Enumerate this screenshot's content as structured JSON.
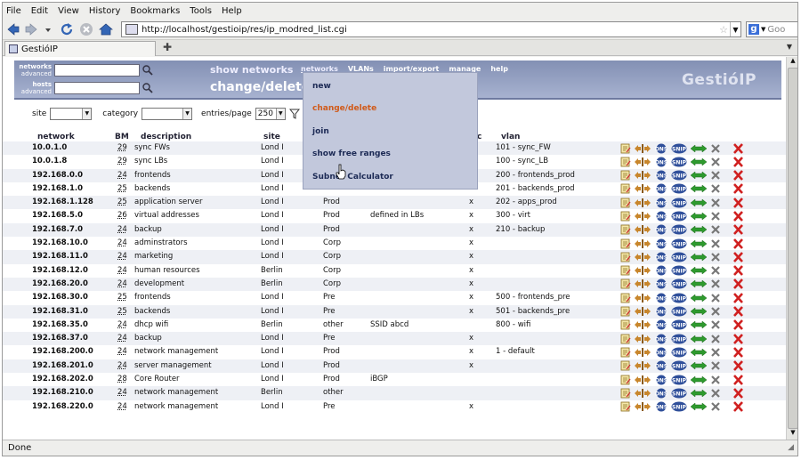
{
  "menubar": [
    "File",
    "Edit",
    "View",
    "History",
    "Bookmarks",
    "Tools",
    "Help"
  ],
  "url": "http://localhost/gestioip/res/ip_modred_list.cgi",
  "search_placeholder": "Goo",
  "tab_title": "GestióIP",
  "status": "Done",
  "header": {
    "networks_label": "networks",
    "networks_sub": "advanced",
    "hosts_label": "hosts",
    "hosts_sub": "advanced",
    "show_networks": "show networks",
    "change_delete": "change/delete",
    "nav": [
      "networks",
      "VLANs",
      "import/export",
      "manage",
      "help"
    ],
    "brand": "GestióIP"
  },
  "dropdown": [
    "new",
    "change/delete",
    "join",
    "show free ranges",
    "Subnet Calculator"
  ],
  "filters": {
    "site_label": "site",
    "site_value": "",
    "category_label": "category",
    "category_value": "",
    "entries_label": "entries/page",
    "entries_value": "250"
  },
  "columns": {
    "network": "network",
    "bm": "BM",
    "description": "description",
    "site": "site",
    "cat_trunc": "c",
    "vlan": "vlan"
  },
  "rows": [
    {
      "net": "10.0.1.0",
      "bm": "29",
      "desc": "sync FWs",
      "site": "Lond I",
      "cat": "",
      "com": "",
      "x": "",
      "vlan": "101 - sync_FW"
    },
    {
      "net": "10.0.1.8",
      "bm": "29",
      "desc": "sync LBs",
      "site": "Lond I",
      "cat": "",
      "com": "",
      "x": "",
      "vlan": "100 - sync_LB"
    },
    {
      "net": "192.168.0.0",
      "bm": "24",
      "desc": "frontends",
      "site": "Lond I",
      "cat": "",
      "com": "",
      "x": "",
      "vlan": "200 - frontends_prod"
    },
    {
      "net": "192.168.1.0",
      "bm": "25",
      "desc": "backends",
      "site": "Lond I",
      "cat": "",
      "com": "",
      "x": "",
      "vlan": "201 - backends_prod"
    },
    {
      "net": "192.168.1.128",
      "bm": "25",
      "desc": "application server",
      "site": "Lond I",
      "cat": "Prod",
      "com": "",
      "x": "x",
      "vlan": "202 - apps_prod"
    },
    {
      "net": "192.168.5.0",
      "bm": "26",
      "desc": "virtual addresses",
      "site": "Lond I",
      "cat": "Prod",
      "com": "defined in LBs",
      "x": "x",
      "vlan": "300 - virt"
    },
    {
      "net": "192.168.7.0",
      "bm": "24",
      "desc": "backup",
      "site": "Lond I",
      "cat": "Prod",
      "com": "",
      "x": "x",
      "vlan": "210 - backup"
    },
    {
      "net": "192.168.10.0",
      "bm": "24",
      "desc": "adminstrators",
      "site": "Lond I",
      "cat": "Corp",
      "com": "",
      "x": "x",
      "vlan": ""
    },
    {
      "net": "192.168.11.0",
      "bm": "24",
      "desc": "marketing",
      "site": "Lond I",
      "cat": "Corp",
      "com": "",
      "x": "x",
      "vlan": ""
    },
    {
      "net": "192.168.12.0",
      "bm": "24",
      "desc": "human resources",
      "site": "Berlin",
      "cat": "Corp",
      "com": "",
      "x": "x",
      "vlan": ""
    },
    {
      "net": "192.168.20.0",
      "bm": "24",
      "desc": "development",
      "site": "Berlin",
      "cat": "Corp",
      "com": "",
      "x": "x",
      "vlan": ""
    },
    {
      "net": "192.168.30.0",
      "bm": "25",
      "desc": "frontends",
      "site": "Lond I",
      "cat": "Pre",
      "com": "",
      "x": "x",
      "vlan": "500 - frontends_pre"
    },
    {
      "net": "192.168.31.0",
      "bm": "25",
      "desc": "backends",
      "site": "Lond I",
      "cat": "Pre",
      "com": "",
      "x": "x",
      "vlan": "501 - backends_pre"
    },
    {
      "net": "192.168.35.0",
      "bm": "24",
      "desc": "dhcp wifi",
      "site": "Berlin",
      "cat": "other",
      "com": "SSID abcd",
      "x": "",
      "vlan": "800 - wifi"
    },
    {
      "net": "192.168.37.0",
      "bm": "24",
      "desc": "backup",
      "site": "Lond I",
      "cat": "Pre",
      "com": "",
      "x": "x",
      "vlan": ""
    },
    {
      "net": "192.168.200.0",
      "bm": "24",
      "desc": "network management",
      "site": "Lond I",
      "cat": "Prod",
      "com": "",
      "x": "x",
      "vlan": "1 - default"
    },
    {
      "net": "192.168.201.0",
      "bm": "24",
      "desc": "server management",
      "site": "Lond I",
      "cat": "Prod",
      "com": "",
      "x": "x",
      "vlan": ""
    },
    {
      "net": "192.168.202.0",
      "bm": "28",
      "desc": "Core Router",
      "site": "Lond I",
      "cat": "Prod",
      "com": "iBGP",
      "x": "",
      "vlan": ""
    },
    {
      "net": "192.168.210.0",
      "bm": "24",
      "desc": "network management",
      "site": "Berlin",
      "cat": "other",
      "com": "",
      "x": "",
      "vlan": ""
    },
    {
      "net": "192.168.220.0",
      "bm": "24",
      "desc": "network management",
      "site": "Lond I",
      "cat": "Pre",
      "com": "",
      "x": "x",
      "vlan": ""
    }
  ],
  "action_icons": [
    "edit-icon",
    "split-icon",
    "dns-icon",
    "sync-icon",
    "arrows-icon",
    "tools-icon",
    "delete-icon"
  ],
  "colors": {
    "header": "#8f9bbd",
    "dropdown": "#c2c8dc",
    "hover": "#d05a1a",
    "alt_row": "#eef0f5"
  }
}
